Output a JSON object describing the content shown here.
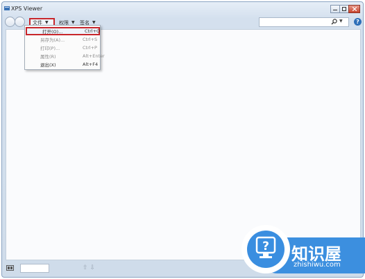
{
  "window": {
    "title": "XPS Viewer"
  },
  "toolbar": {
    "menus": [
      {
        "label": "文件"
      },
      {
        "label": "权限"
      },
      {
        "label": "签名"
      }
    ],
    "search": {
      "value": "",
      "placeholder": ""
    }
  },
  "file_menu": {
    "items": [
      {
        "label": "打开(O)...",
        "shortcut": "Ctrl+O",
        "enabled": true
      },
      {
        "label": "另存为(A)...",
        "shortcut": "Ctrl+S",
        "enabled": false
      },
      {
        "label": "打印(P)...",
        "shortcut": "Ctrl+P",
        "enabled": false
      },
      {
        "label": "属性(R)",
        "shortcut": "Alt+Enter",
        "enabled": false
      },
      {
        "label": "退出(X)",
        "shortcut": "Alt+F4",
        "enabled": true
      }
    ]
  },
  "statusbar": {
    "page_value": ""
  },
  "watermark": {
    "title": "知识屋",
    "url": "zhishiwu.com"
  },
  "colors": {
    "highlight_border": "#c8262b",
    "watermark_blue": "#3c8fdf"
  }
}
